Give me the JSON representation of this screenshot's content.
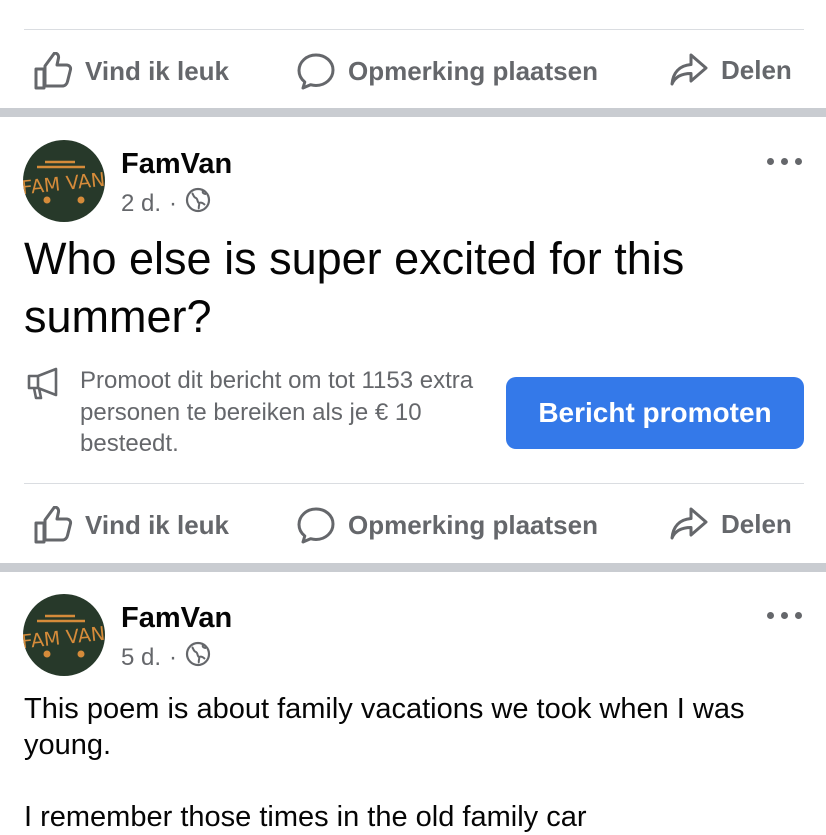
{
  "actions": {
    "like": "Vind ik leuk",
    "comment": "Opmerking plaatsen",
    "share": "Delen"
  },
  "icons": {
    "like": "thumbs-up-icon",
    "comment": "comment-bubble-icon",
    "share": "share-arrow-icon",
    "globe": "globe-icon",
    "megaphone": "megaphone-icon",
    "more": "more-options-icon"
  },
  "colors": {
    "accent": "#3479e9",
    "secondary_text": "#65676b",
    "separator": "#c9ccd1",
    "avatar_bg": "#27392a",
    "avatar_logo": "#d58b3a"
  },
  "posts": [
    {
      "author": "FamVan",
      "avatar_text": "FAM VAN",
      "time": "2 d.",
      "dot": "·",
      "text": "Who else is super excited for this summer?",
      "promo": {
        "text": "Promoot dit bericht om tot 1153 extra personen te bereiken als je € 10 besteedt.",
        "button": "Bericht promoten"
      }
    },
    {
      "author": "FamVan",
      "avatar_text": "FAM VAN",
      "time": "5 d.",
      "dot": "·",
      "text_line1": "This poem is about family vacations we took when I was young.",
      "text_line2": "I remember those times in the old family car"
    }
  ]
}
